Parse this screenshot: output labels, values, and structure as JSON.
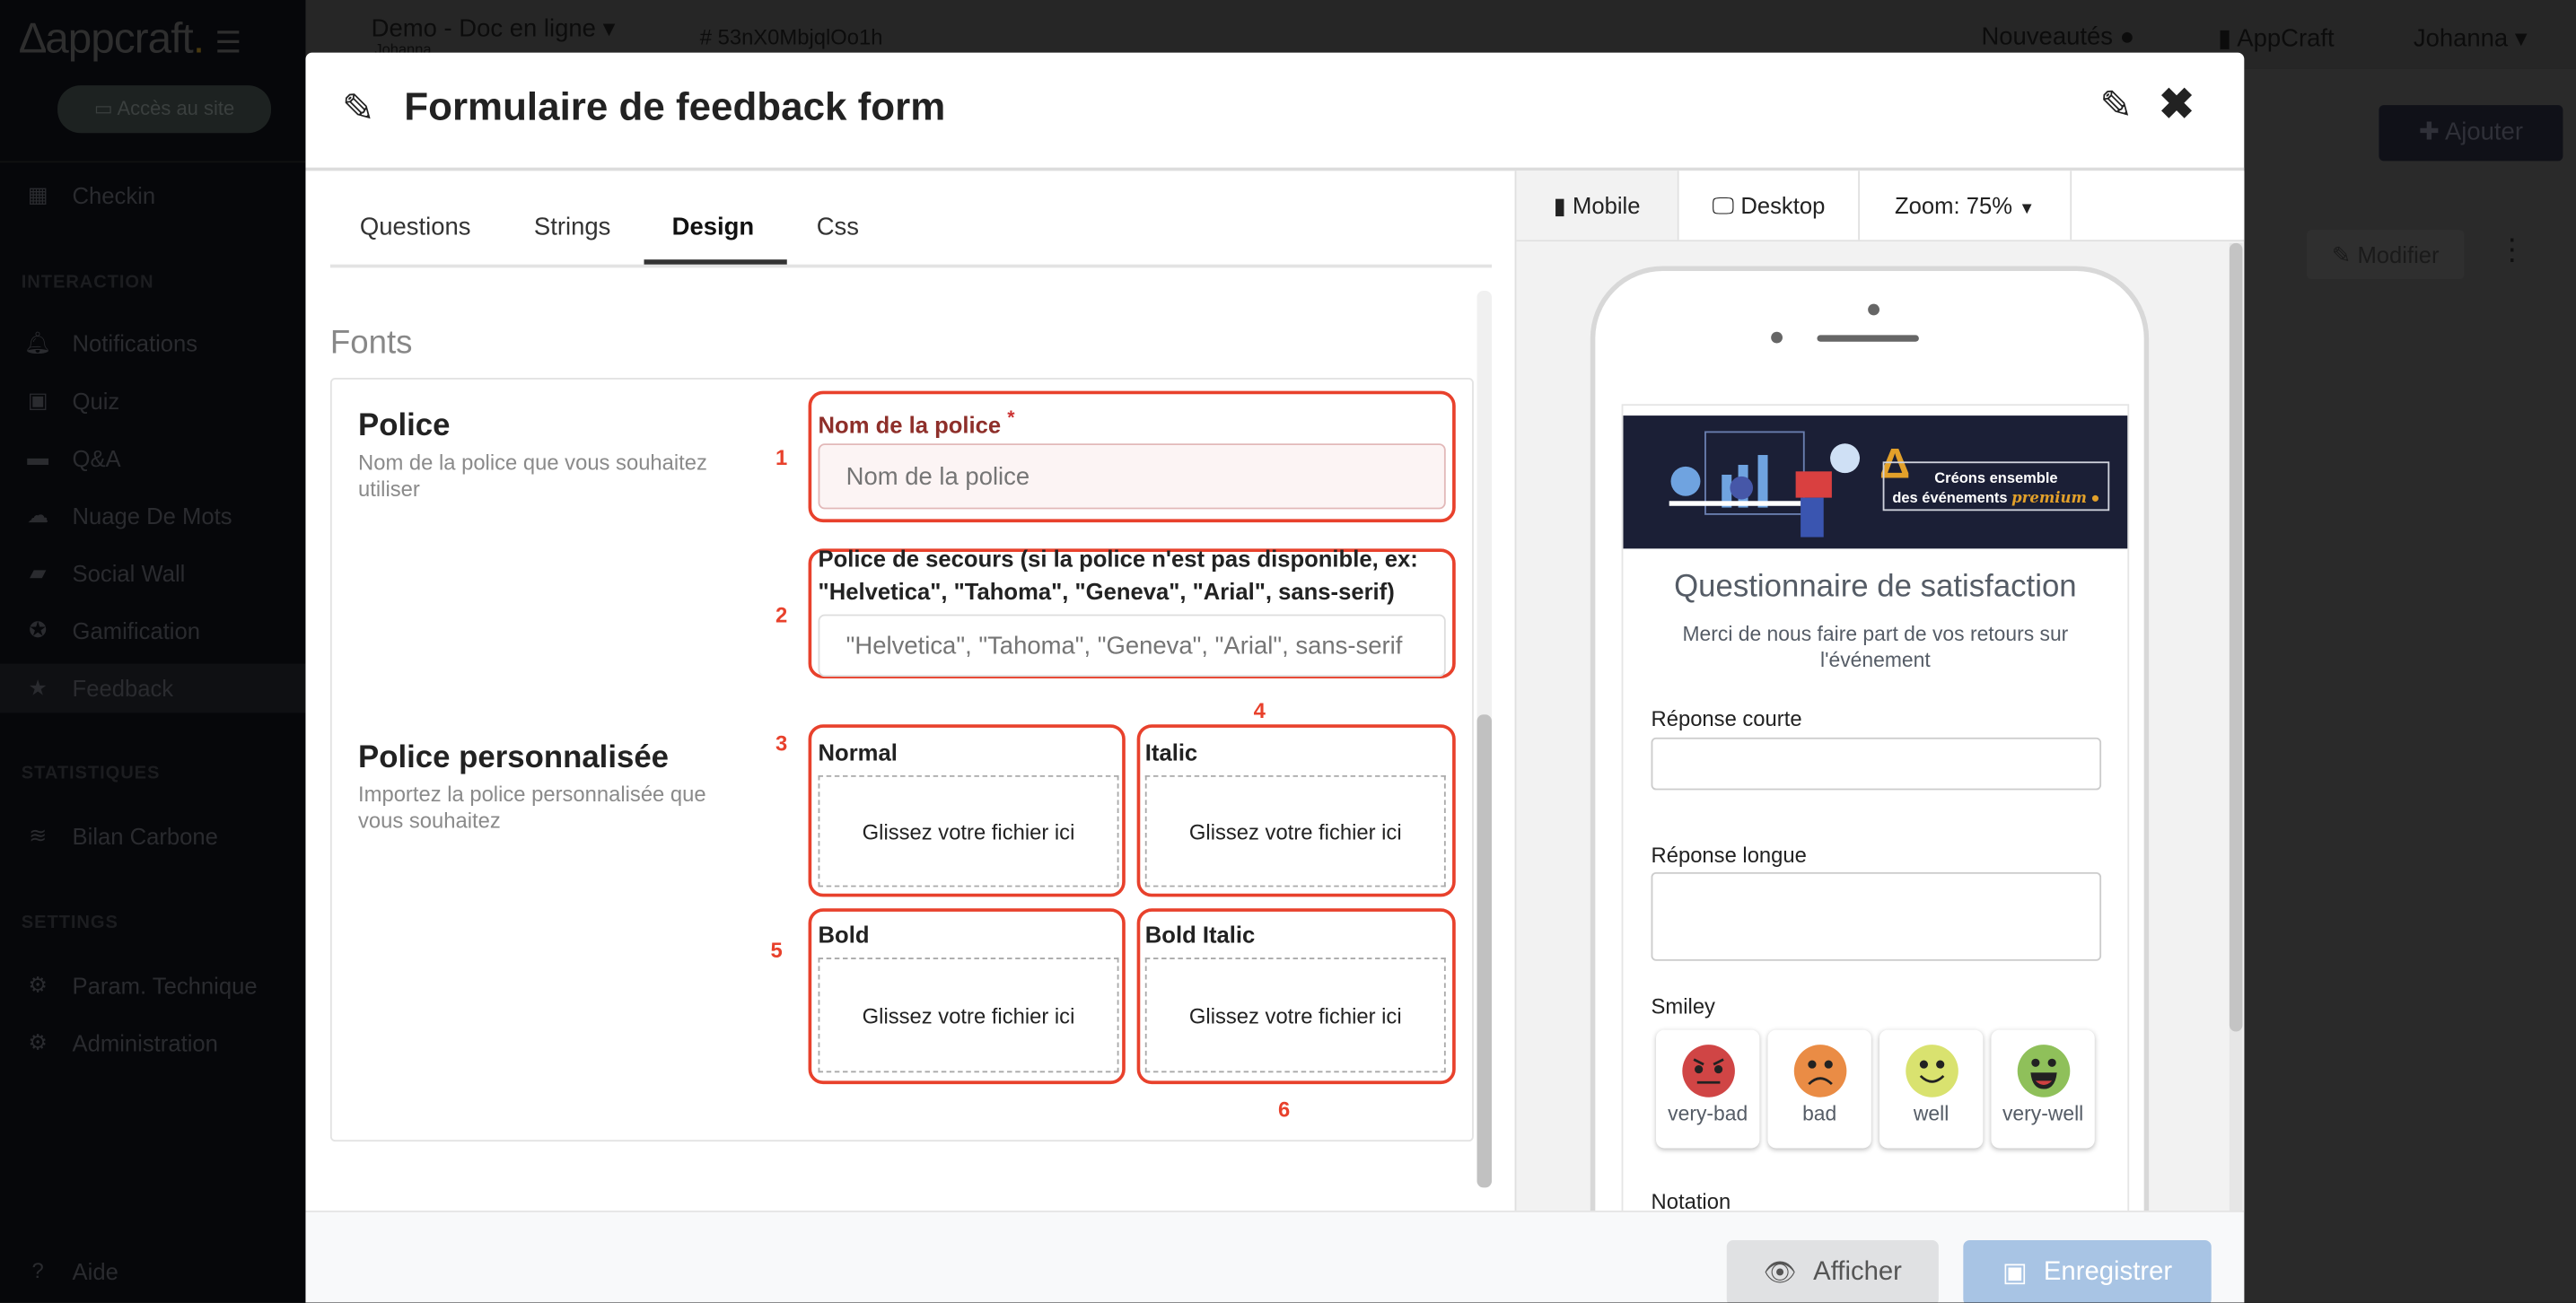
{
  "topbar": {
    "project": "Demo - Doc en ligne",
    "project_sub": "Johanna",
    "event_id": "# 53nX0MbjqlOo1h",
    "news": "Nouveautés",
    "org": "AppCraft",
    "user": "Johanna"
  },
  "sidebar": {
    "logo": "appcraft",
    "logo_dot": ".",
    "acces": "Accès au site",
    "checkin": "Checkin",
    "sections": {
      "interaction": "INTERACTION",
      "stats": "STATISTIQUES",
      "settings": "SETTINGS"
    },
    "items": [
      {
        "label": "Notifications",
        "icon": "bell-icon"
      },
      {
        "label": "Quiz",
        "icon": "quiz-icon"
      },
      {
        "label": "Q&A",
        "icon": "chat-icon"
      },
      {
        "label": "Nuage De Mots",
        "icon": "cloud-icon"
      },
      {
        "label": "Social Wall",
        "icon": "image-icon"
      },
      {
        "label": "Gamification",
        "icon": "star-circle-icon"
      },
      {
        "label": "Feedback",
        "icon": "star-icon",
        "active": true
      }
    ],
    "stats_items": [
      {
        "label": "Bilan Carbone"
      }
    ],
    "settings_items": [
      {
        "label": "Param. Technique"
      },
      {
        "label": "Administration"
      }
    ],
    "help": "Aide"
  },
  "background": {
    "add_button": "Ajouter",
    "modify_button": "Modifier"
  },
  "modal": {
    "title": "Formulaire de feedback form",
    "tabs": [
      "Questions",
      "Strings",
      "Design",
      "Css"
    ],
    "active_tab": "Design",
    "section": "Fonts",
    "police": {
      "title": "Police",
      "desc": "Nom de la police que vous souhaitez utiliser",
      "name_label": "Nom de la police",
      "required": "*",
      "name_placeholder": "Nom de la police",
      "fallback_label": "Police de secours (si la police n'est pas disponible, ex: \"Helvetica\", \"Tahoma\", \"Geneva\", \"Arial\", sans-serif)",
      "fallback_placeholder": "\"Helvetica\", \"Tahoma\", \"Geneva\", \"Arial\", sans-serif"
    },
    "custom": {
      "title": "Police personnalisée",
      "desc": "Importez la police personnalisée que vous souhaitez",
      "slots": [
        {
          "label": "Normal",
          "drop": "Glissez votre fichier ici"
        },
        {
          "label": "Italic",
          "drop": "Glissez votre fichier ici"
        },
        {
          "label": "Bold",
          "drop": "Glissez votre fichier ici"
        },
        {
          "label": "Bold Italic",
          "drop": "Glissez votre fichier ici"
        }
      ]
    },
    "annotations": [
      "1",
      "2",
      "3",
      "4",
      "5",
      "6"
    ],
    "annotation_color": "#e8412c",
    "preview": {
      "mobile": "Mobile",
      "desktop": "Desktop",
      "zoom": "Zoom: 75%",
      "banner_line1": "Créons ensemble",
      "banner_line2": "des événements",
      "banner_accent": "premium",
      "title": "Questionnaire de satisfaction",
      "subtitle": "Merci de nous faire part de vos retours sur l'événement",
      "short": "Réponse courte",
      "long": "Réponse longue",
      "smiley": "Smiley",
      "smileys": [
        {
          "label": "very-bad",
          "color": "#d04545"
        },
        {
          "label": "bad",
          "color": "#ea8c45"
        },
        {
          "label": "well",
          "color": "#d9e26f"
        },
        {
          "label": "very-well",
          "color": "#8fc05a"
        }
      ],
      "notation": "Notation"
    },
    "footer": {
      "show": "Afficher",
      "save": "Enregistrer"
    }
  }
}
